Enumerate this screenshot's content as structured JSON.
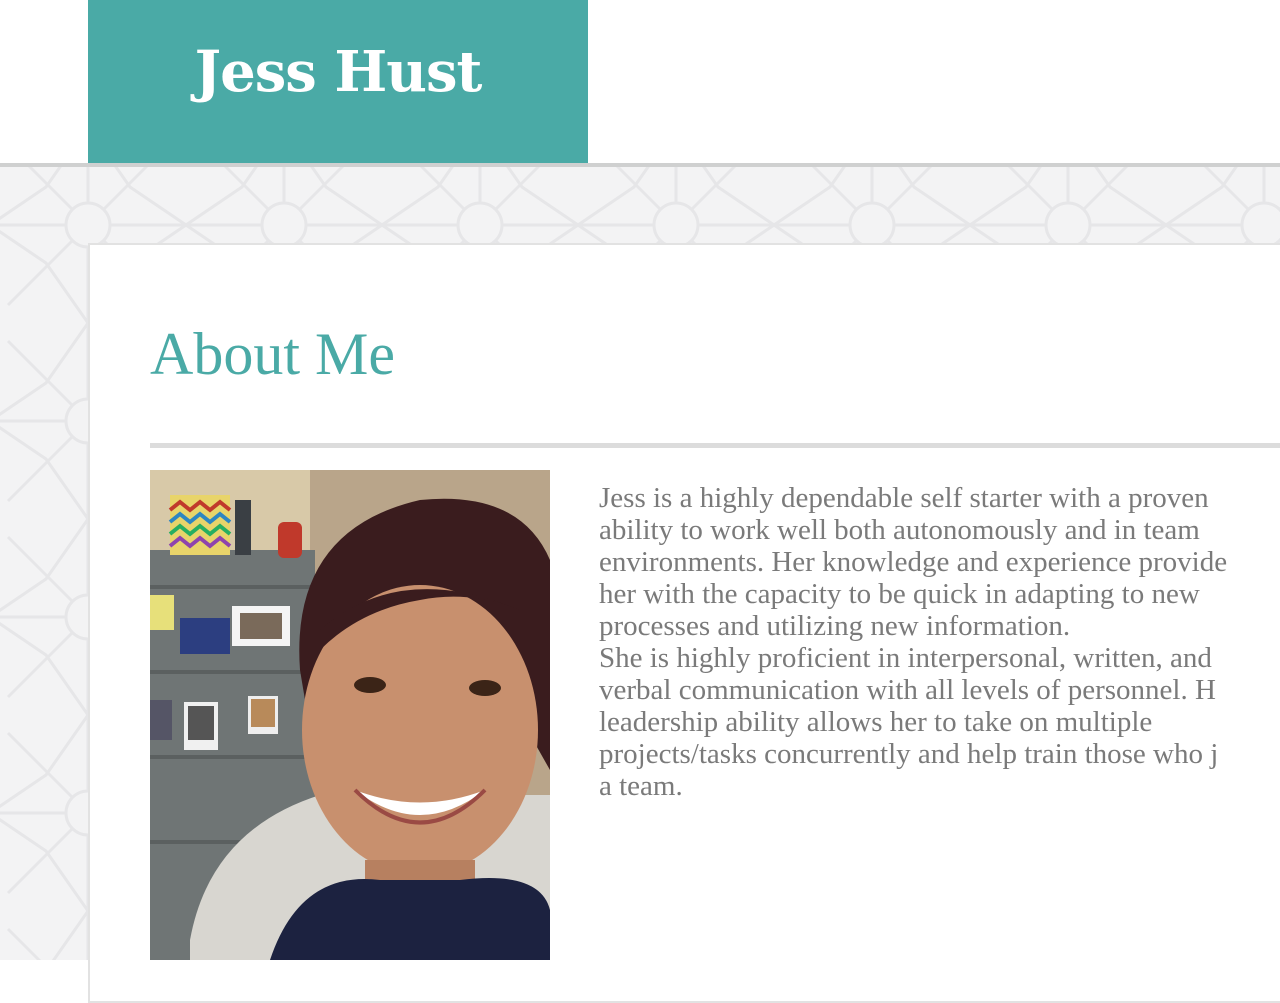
{
  "header": {
    "site_name": "Jess Hust"
  },
  "colors": {
    "brand": "#4aaaa6",
    "text": "#7a7a7a",
    "rule": "#dcdcdc",
    "background_pattern": "#f3f3f4"
  },
  "about": {
    "title": "About Me",
    "photo_alt": "Portrait photo",
    "bio_lines": [
      "Jess is a highly dependable self starter with a proven",
      "ability to work well both autonomously and in team",
      "environments. Her knowledge and experience provide",
      "her with the capacity to be quick in adapting to new",
      "processes and utilizing new information.",
      "She is highly proficient in interpersonal, written, and",
      "verbal communication with all levels of personnel. H",
      "leadership ability allows her to take on multiple",
      "projects/tasks concurrently and help train those who j",
      "a team."
    ]
  }
}
